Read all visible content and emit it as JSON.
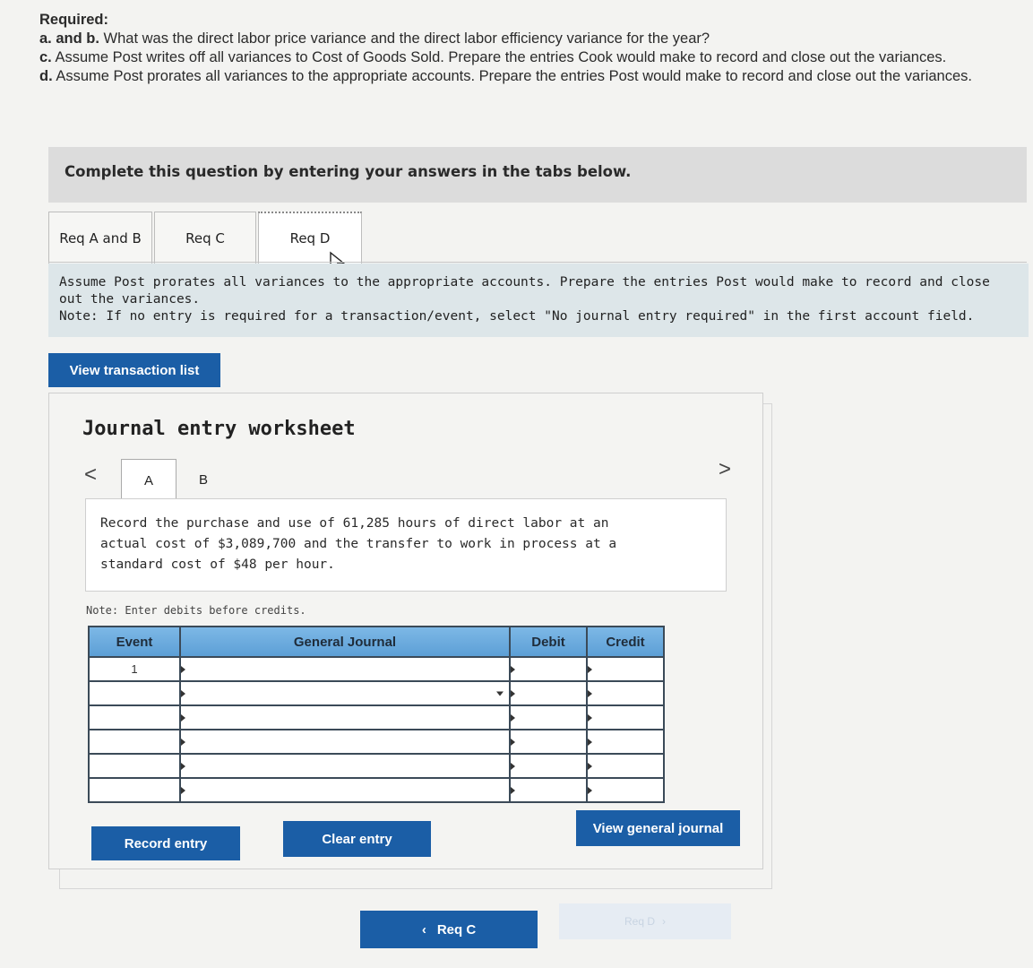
{
  "required": {
    "heading": "Required:",
    "ab_prefix": "a. and b.",
    "ab_text": " What was the direct labor price variance and the direct labor efficiency variance for the year?",
    "c_prefix": "c.",
    "c_text": " Assume Post writes off all variances to Cost of Goods Sold. Prepare the entries Cook would make to record and close out the variances.",
    "d_prefix": "d.",
    "d_text": " Assume Post prorates all variances to the appropriate accounts. Prepare the entries Post would make to record and close out the variances."
  },
  "banner": "Complete this question by entering your answers in the tabs below.",
  "tabs": [
    {
      "label": "Req A and B"
    },
    {
      "label": "Req C"
    },
    {
      "label": "Req D",
      "active": true
    }
  ],
  "instructions": {
    "line1": "Assume Post prorates all variances to the appropriate accounts. Prepare the entries Post would make to record and close out the variances.",
    "note": "Note: If no entry is required for a transaction/event, select \"No journal entry required\" in the first account field."
  },
  "view_transaction_button": "View transaction list",
  "worksheet": {
    "title": "Journal entry worksheet",
    "subtabs": [
      "A",
      "B"
    ],
    "prev_arrow": "<",
    "next_arrow": ">",
    "description": "Record the purchase and use of 61,285 hours of direct labor at an actual cost of $3,089,700 and the transfer to work in process at a standard cost of $48 per hour.",
    "note": "Note: Enter debits before credits.",
    "table": {
      "headers": {
        "event": "Event",
        "journal": "General Journal",
        "debit": "Debit",
        "credit": "Credit"
      },
      "rows": [
        {
          "event": "1",
          "account": "",
          "debit": "",
          "credit": ""
        },
        {
          "event": "",
          "account": "",
          "debit": "",
          "credit": ""
        },
        {
          "event": "",
          "account": "",
          "debit": "",
          "credit": ""
        },
        {
          "event": "",
          "account": "",
          "debit": "",
          "credit": ""
        },
        {
          "event": "",
          "account": "",
          "debit": "",
          "credit": ""
        },
        {
          "event": "",
          "account": "",
          "debit": "",
          "credit": ""
        }
      ]
    },
    "buttons": {
      "record": "Record entry",
      "clear": "Clear entry",
      "view_journal": "View general journal"
    }
  },
  "footer_nav": {
    "prev_label": "Req C",
    "next_label": "Req D"
  },
  "colors": {
    "button_blue": "#1b5ea6",
    "table_header": "#5fa3d9",
    "instruction_bg": "#dde6e9"
  }
}
